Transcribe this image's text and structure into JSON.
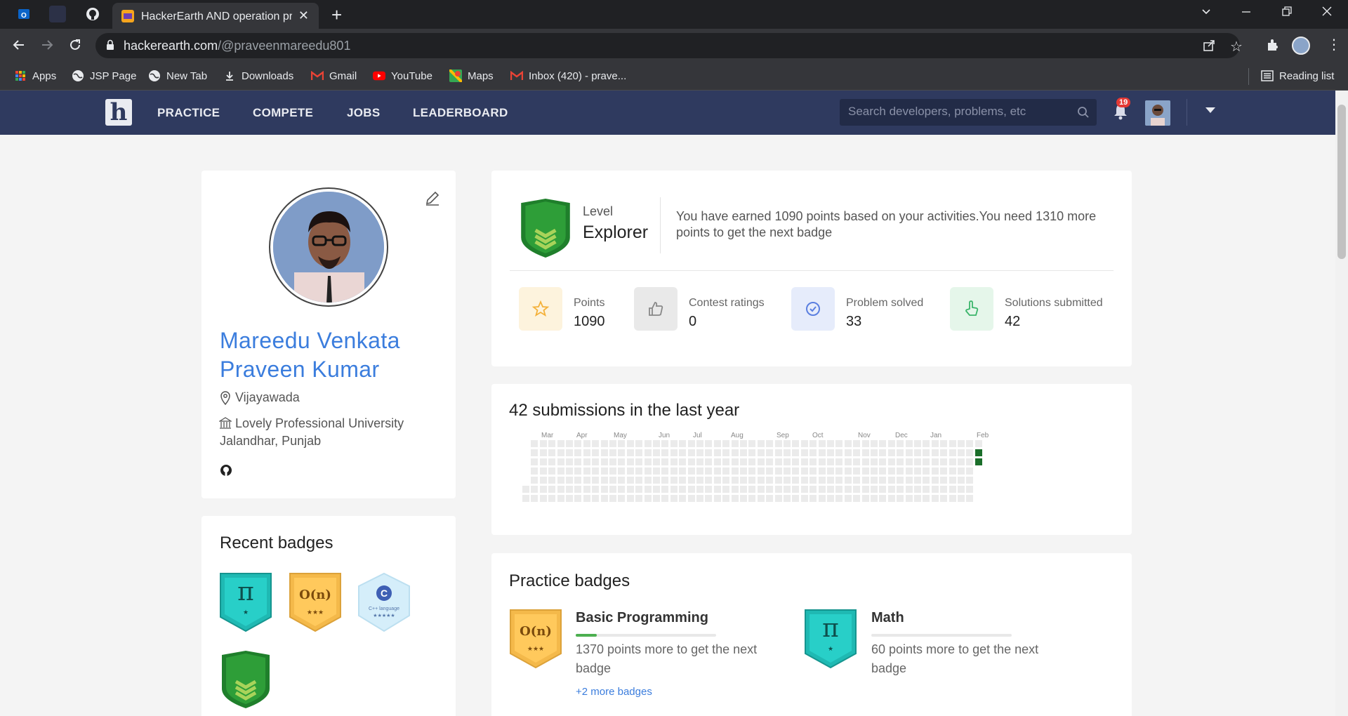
{
  "browser": {
    "tab_title": "HackerEarth AND operation prob",
    "tab_close": "✕",
    "new_tab": "+",
    "url_host": "hackerearth.com",
    "url_path": "/@praveenmareedu801",
    "bookmarks": [
      {
        "label": "Apps",
        "icon": "apps-grid-icon"
      },
      {
        "label": "JSP Page",
        "icon": "globe-icon"
      },
      {
        "label": "New Tab",
        "icon": "globe-icon"
      },
      {
        "label": "Downloads",
        "icon": "download-icon"
      },
      {
        "label": "Gmail",
        "icon": "gmail-icon"
      },
      {
        "label": "YouTube",
        "icon": "youtube-icon"
      },
      {
        "label": "Maps",
        "icon": "maps-icon"
      },
      {
        "label": "Inbox (420) - prave...",
        "icon": "gmail-icon"
      }
    ],
    "reading_list": "Reading list"
  },
  "site_nav": {
    "logo": "h",
    "links": [
      "PRACTICE",
      "COMPETE",
      "JOBS",
      "LEADERBOARD"
    ],
    "search_placeholder": "Search developers, problems, etc",
    "notification_count": "19"
  },
  "profile": {
    "name": "Mareedu Venkata Praveen Kumar",
    "location": "Vijayawada",
    "university": "Lovely Professional University Jalandhar, Punjab"
  },
  "recent_badges": {
    "title": "Recent badges",
    "badges": [
      {
        "glyph": "π",
        "stars": "★",
        "color": "#1fb9b3"
      },
      {
        "glyph": "O(n)",
        "stars": "★★★",
        "color": "#f4b94a"
      },
      {
        "glyph": "C",
        "stars": "C++ language ★★★★★",
        "color": "#d5eefa"
      }
    ]
  },
  "level": {
    "label": "Level",
    "name": "Explorer",
    "message": "You have earned 1090 points based on your activities.You need 1310 more points to get the next badge"
  },
  "stats": [
    {
      "label": "Points",
      "value": "1090",
      "icon": "star-icon",
      "bg": "#fdf3dd"
    },
    {
      "label": "Contest ratings",
      "value": "0",
      "icon": "thumbs-up-icon",
      "bg": "#e9e9e9"
    },
    {
      "label": "Problem solved",
      "value": "33",
      "icon": "check-circle-icon",
      "bg": "#e6ecfb"
    },
    {
      "label": "Solutions submitted",
      "value": "42",
      "icon": "hand-pointer-icon",
      "bg": "#e5f6ea"
    }
  ],
  "submissions": {
    "title": "42 submissions in the last year",
    "months": [
      "Mar",
      "Apr",
      "May",
      "Jun",
      "Jul",
      "Aug",
      "Sep",
      "Oct",
      "Nov",
      "Dec",
      "Jan",
      "Feb"
    ]
  },
  "practice_badges": {
    "title": "Practice badges",
    "items": [
      {
        "title": "Basic Programming",
        "desc": "1370 points more to get the next badge",
        "more": "+2 more badges",
        "glyph": "O(n)",
        "stars": "★★★",
        "progress": 0.15
      },
      {
        "title": "Math",
        "desc": "60 points more to get the next badge",
        "more": "",
        "glyph": "π",
        "stars": "★",
        "progress": 0.0
      }
    ]
  },
  "colors": {
    "nav_bg": "#2f3a5f",
    "name_blue": "#3b7ddd",
    "heat_active": "#1b6e2a",
    "heat_empty": "#ebebeb"
  }
}
